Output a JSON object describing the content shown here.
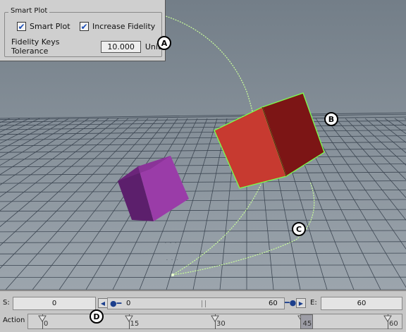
{
  "smart_plot": {
    "title": "Smart Plot",
    "checkbox_smart_plot": {
      "label": "Smart Plot",
      "checked": true
    },
    "checkbox_increase_fidelity": {
      "label": "Increase Fidelity",
      "checked": true
    },
    "tolerance_label": "Fidelity Keys Tolerance",
    "tolerance_value": "10.000",
    "units_label": "Units"
  },
  "callouts": {
    "a": "A",
    "b": "B",
    "c": "C",
    "d": "D"
  },
  "timeline": {
    "start_label": "S:",
    "start_value": "0",
    "end_label": "E:",
    "end_value": "60",
    "range_start": "0",
    "range_end": "60",
    "action_label": "Action",
    "ticks": [
      "0",
      "15",
      "30",
      "45",
      "60"
    ],
    "current_frame": "45"
  },
  "colors": {
    "background_top": "#7d8790",
    "background_bottom": "#96a0a9",
    "grid": "#3a4450",
    "cube_red_front": "#c8342a",
    "cube_red_side": "#7e1414",
    "cube_purple_front": "#9a3aa8",
    "cube_purple_side": "#5f2070",
    "trajectory": "#c8ff9a",
    "selection": "#8aff5a"
  }
}
